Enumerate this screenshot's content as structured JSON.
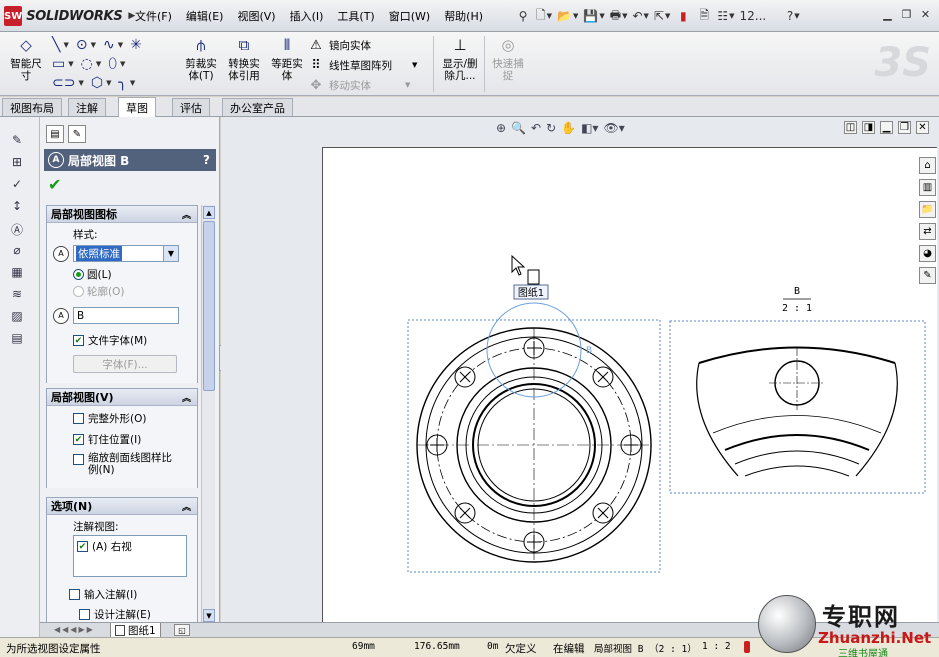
{
  "app": {
    "logo_short": "SW",
    "logo_text": "SOLIDWORKS"
  },
  "menu": [
    "文件(F)",
    "编辑(E)",
    "视图(V)",
    "插入(I)",
    "工具(T)",
    "窗口(W)",
    "帮助(H)"
  ],
  "quickbar": {
    "search_text": "12...",
    "help": "?"
  },
  "commands": {
    "smart_dim": "智能尺\n寸",
    "trim": "剪裁实\n体(T)",
    "convert": "转换实\n体引用",
    "offset": "等距实\n体",
    "mirror": "镜向实体",
    "linear_pattern": "线性草图阵列",
    "move": "移动实体",
    "show_hide": "显示/删\n除几...",
    "quick_snap": "快速捕\n捉"
  },
  "tabs": [
    "视图布局",
    "注解",
    "草图",
    "评估",
    "办公室产品"
  ],
  "active_tab": "草图",
  "property_manager": {
    "title": "局部视图 B",
    "help": "?",
    "groups": {
      "icon": {
        "label": "局部视图图标",
        "style_label": "样式:",
        "style_value": "依照标准",
        "radio_circle": "圆(L)",
        "radio_profile": "轮廓(O)",
        "label_value": "B",
        "doc_font": "文件字体(M)",
        "font_button": "字体(F)..."
      },
      "detail": {
        "label": "局部视图(V)",
        "full_outline": "完整外形(O)",
        "pin_position": "钉住位置(I)",
        "scale_hatch": "缩放剖面线图样比\n例(N)"
      },
      "options": {
        "label": "选项(N)",
        "annot_view_label": "注解视图:",
        "annot_item": "(A) 右视",
        "import_annot": "输入注解(I)",
        "design_annot": "设计注解(E)"
      }
    }
  },
  "drawing": {
    "sheet_tooltip": "图纸1",
    "detail_label": "B",
    "detail_scale": "2 : 1",
    "circle_label": "B"
  },
  "sheet_tab": "图纸1",
  "status": {
    "prompt": "为所选视图设定属性",
    "x": "69mm",
    "y": "176.65mm",
    "z": "0m",
    "defined": "欠定义",
    "mode": "在编辑",
    "view": "局部视图 B （2 : 1）",
    "scale": "1 : 2"
  },
  "watermark": {
    "title": "专职网",
    "url": "Zhuanzhi.Net",
    "sub": "三维书屋通"
  },
  "colors": {
    "pm_header": "#52617c",
    "accent_red": "#c8202a",
    "check_green": "#1a9a1a"
  }
}
